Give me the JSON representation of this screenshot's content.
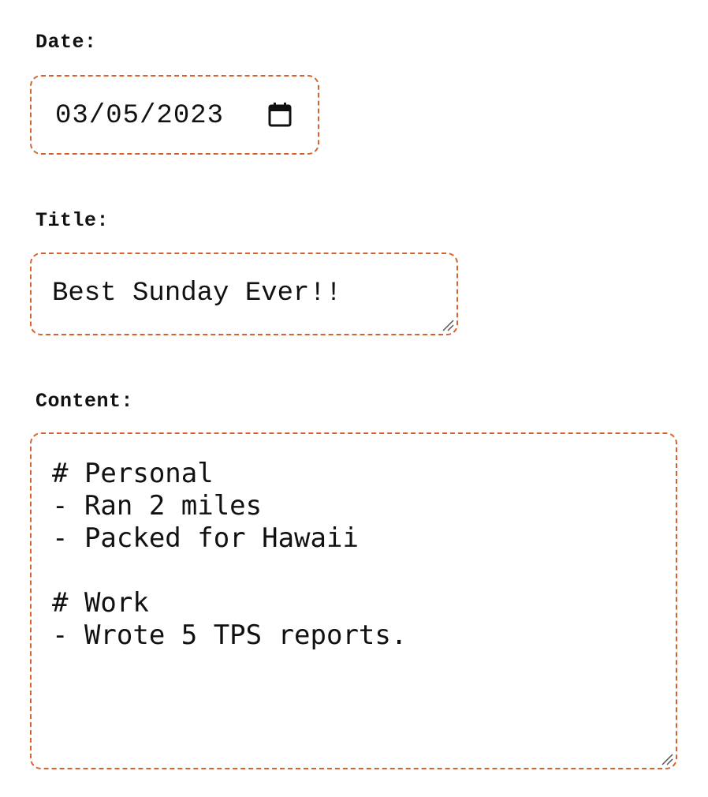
{
  "form": {
    "date": {
      "label": "Date:",
      "value": "03/05/2023",
      "icon": "calendar-icon"
    },
    "title": {
      "label": "Title:",
      "value": "Best Sunday Ever!!"
    },
    "content": {
      "label": "Content:",
      "value": "# Personal\n- Ran 2 miles\n- Packed for Hawaii\n\n# Work\n- Wrote 5 TPS reports."
    }
  },
  "colors": {
    "border": "#d5632f",
    "text": "#111111",
    "background": "#ffffff"
  }
}
